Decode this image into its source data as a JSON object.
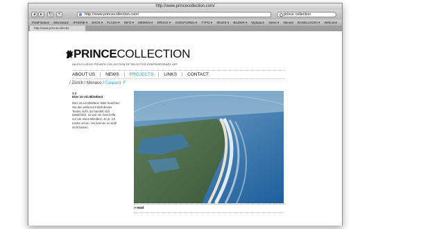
{
  "browser": {
    "window_title": "http://www.princecollection.com/",
    "url": "http://www.princecollection.com/",
    "search_query": "prince collection",
    "tab_title": "http://www.princecollectio",
    "bookmarks": [
      "PostFinance",
      "Microwurtz",
      "IPHONE ▾",
      "ZHCK ▾",
      "FLASH ▾",
      "INFO ▾",
      "MEDIEN ▾",
      "DRUCK ▾",
      "AGENTUREN ▾",
      "TYPO ▾",
      "MUSIK ▾",
      "BILDER ▾",
      "MySpace",
      "News ▾",
      "Neneal",
      "BASELLOOGI ▾",
      "Welcome"
    ],
    "buttons": {
      "back": "◂",
      "forward": "▸",
      "reload": "↻",
      "add": "+"
    }
  },
  "site": {
    "logo_bold": "PRINCE",
    "logo_light": "COLLECTION",
    "tagline": "AN EXCLUSIVE PRIVATE COLLECTION OF SELECTED CONTEMPORARY ART",
    "nav": [
      {
        "label": "ABOUT US"
      },
      {
        "label": "NEWS"
      },
      {
        "label": "PROJECTS"
      },
      {
        "label": "LINKS"
      },
      {
        "label": "CONTACT"
      }
    ],
    "breadcrumb": {
      "prefix": "/ Zürich / Monaco /",
      "current": " Caspard. F"
    },
    "article": {
      "number": "1.1",
      "title": "Dies ist ein Blindtext",
      "body": "Dies ist ein Blindtext. Bitte beachten Sie den weiteren Inhalt dieses Textes nicht. Es handelt sich tatsächlich, so war mir Gott helfe, nur um einen Blindtext. Je je, ich merke schon, Sie können es wohl nicht lassen."
    },
    "next_label": "> next"
  },
  "colors": {
    "accent": "#2a9fd6",
    "text": "#111111"
  }
}
